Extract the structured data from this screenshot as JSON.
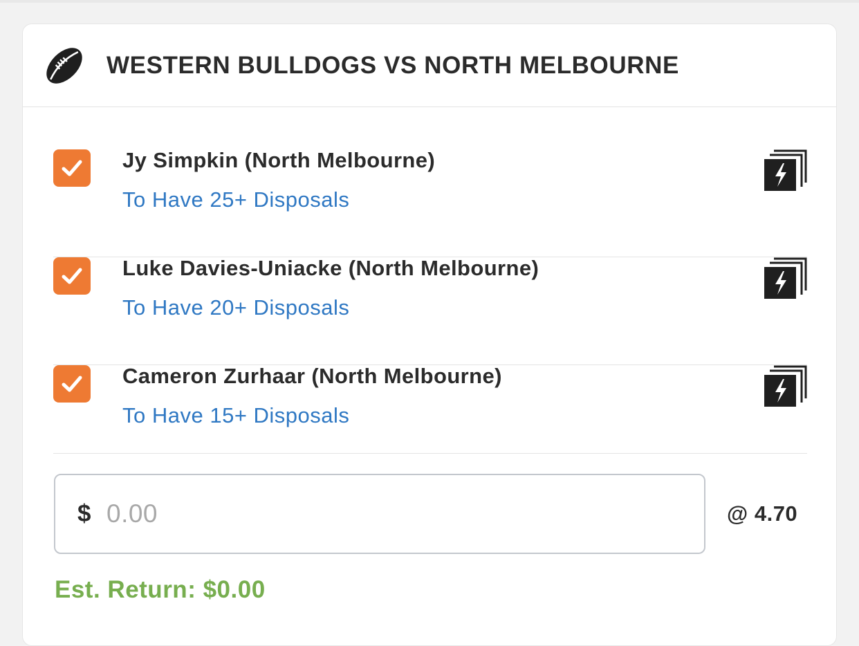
{
  "match": {
    "title": "WESTERN BULLDOGS VS NORTH MELBOURNE",
    "icon": "football-icon"
  },
  "selections": [
    {
      "runner": "Jy Simpkin (North Melbourne)",
      "market": "To Have 25+ Disposals",
      "checked": true
    },
    {
      "runner": "Luke Davies-Uniacke (North Melbourne)",
      "market": "To Have 20+ Disposals",
      "checked": true
    },
    {
      "runner": "Cameron Zurhaar (North Melbourne)",
      "market": "To Have 15+ Disposals",
      "checked": true
    }
  ],
  "stake": {
    "currency": "$",
    "placeholder": "0.00"
  },
  "odds": "@ 4.70",
  "est_return": "Est. Return: $0.00",
  "colors": {
    "checkbox": "#ee7a33",
    "market_link": "#2f78c3",
    "est_return": "#77ae4f"
  }
}
